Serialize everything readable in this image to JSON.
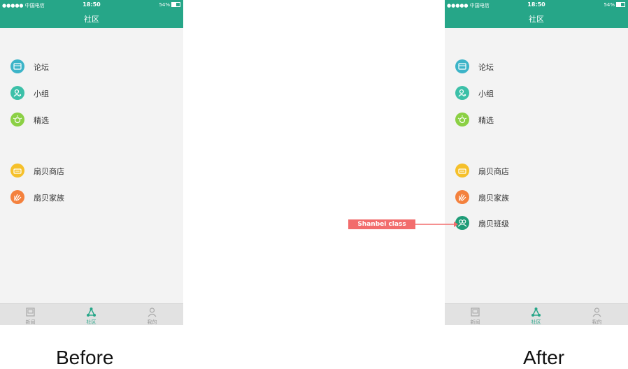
{
  "before": {
    "status": {
      "carrier": "●●●●● 中国电信",
      "time": "18:50",
      "battery": "54%"
    },
    "title": "社区",
    "groups": [
      [
        {
          "label": "论坛",
          "icon": "forum-icon",
          "color": "#3cb4c8"
        },
        {
          "label": "小组",
          "icon": "group-icon",
          "color": "#3cc0a8"
        },
        {
          "label": "精选",
          "icon": "featured-icon",
          "color": "#8bd044"
        }
      ],
      [
        {
          "label": "扇贝商店",
          "icon": "store-icon",
          "color": "#f5c02a"
        },
        {
          "label": "扇贝家族",
          "icon": "family-icon",
          "color": "#f4813d"
        }
      ]
    ],
    "tabs": [
      {
        "label": "新闻",
        "icon": "news-icon",
        "active": false
      },
      {
        "label": "社区",
        "icon": "community-icon",
        "active": true
      },
      {
        "label": "我的",
        "icon": "profile-icon",
        "active": false
      }
    ]
  },
  "after": {
    "status": {
      "carrier": "●●●●● 中国电信",
      "time": "18:50",
      "battery": "54%"
    },
    "title": "社区",
    "groups": [
      [
        {
          "label": "论坛",
          "icon": "forum-icon",
          "color": "#3cb4c8"
        },
        {
          "label": "小组",
          "icon": "group-icon",
          "color": "#3cc0a8"
        },
        {
          "label": "精选",
          "icon": "featured-icon",
          "color": "#8bd044"
        }
      ],
      [
        {
          "label": "扇贝商店",
          "icon": "store-icon",
          "color": "#f5c02a"
        },
        {
          "label": "扇贝家族",
          "icon": "family-icon",
          "color": "#f4813d"
        },
        {
          "label": "扇贝班级",
          "icon": "class-icon",
          "color": "#1f9c77"
        }
      ]
    ],
    "tabs": [
      {
        "label": "新闻",
        "icon": "news-icon",
        "active": false
      },
      {
        "label": "社区",
        "icon": "community-icon",
        "active": true
      },
      {
        "label": "我的",
        "icon": "profile-icon",
        "active": false
      }
    ]
  },
  "annotation": "Shanbei class",
  "captions": {
    "before": "Before",
    "after": "After"
  },
  "colors": {
    "brand": "#26a688",
    "annotation": "#f26c6c"
  }
}
